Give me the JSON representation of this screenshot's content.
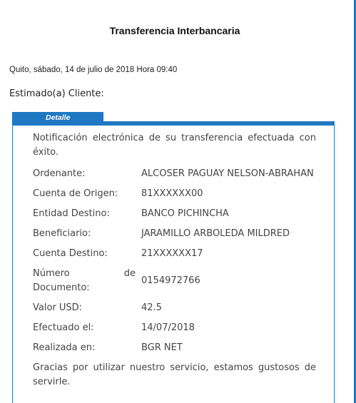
{
  "header": {
    "title": "Transferencia Interbancaria",
    "dateline": "Quito, sábado, 14 de julio de 2018 Hora 09:40",
    "greeting": "Estimado(a) Cliente:"
  },
  "detail": {
    "tab_label": "Detalle",
    "intro": "Notificación electrónica de su transferencia efectuada con éxito.",
    "fields": {
      "ordenante": {
        "label": "Ordenante:",
        "value": "ALCOSER PAGUAY NELSON-ABRAHAN"
      },
      "cuenta_origen": {
        "label": "Cuenta de Origen:",
        "value": "81XXXXXX00"
      },
      "entidad_destino": {
        "label": "Entidad Destino:",
        "value": "BANCO PICHINCHA"
      },
      "beneficiario": {
        "label": "Beneficiario:",
        "value": "JARAMILLO ARBOLEDA MILDRED"
      },
      "cuenta_destino": {
        "label": "Cuenta Destino:",
        "value": "21XXXXXX17"
      },
      "numero_documento": {
        "label_word1": "Número",
        "label_word2": "de",
        "label_line2": "Documento:",
        "value": "0154972766"
      },
      "valor_usd": {
        "label": "Valor USD:",
        "value": "42.5"
      },
      "efectuado": {
        "label": "Efectuado el:",
        "value": "14/07/2018"
      },
      "realizada": {
        "label": "Realizada en:",
        "value": "BGR NET"
      }
    },
    "thanks": "Gracias por utilizar nuestro servicio, estamos gustosos de servirle."
  },
  "colors": {
    "accent": "#1f78c2"
  }
}
